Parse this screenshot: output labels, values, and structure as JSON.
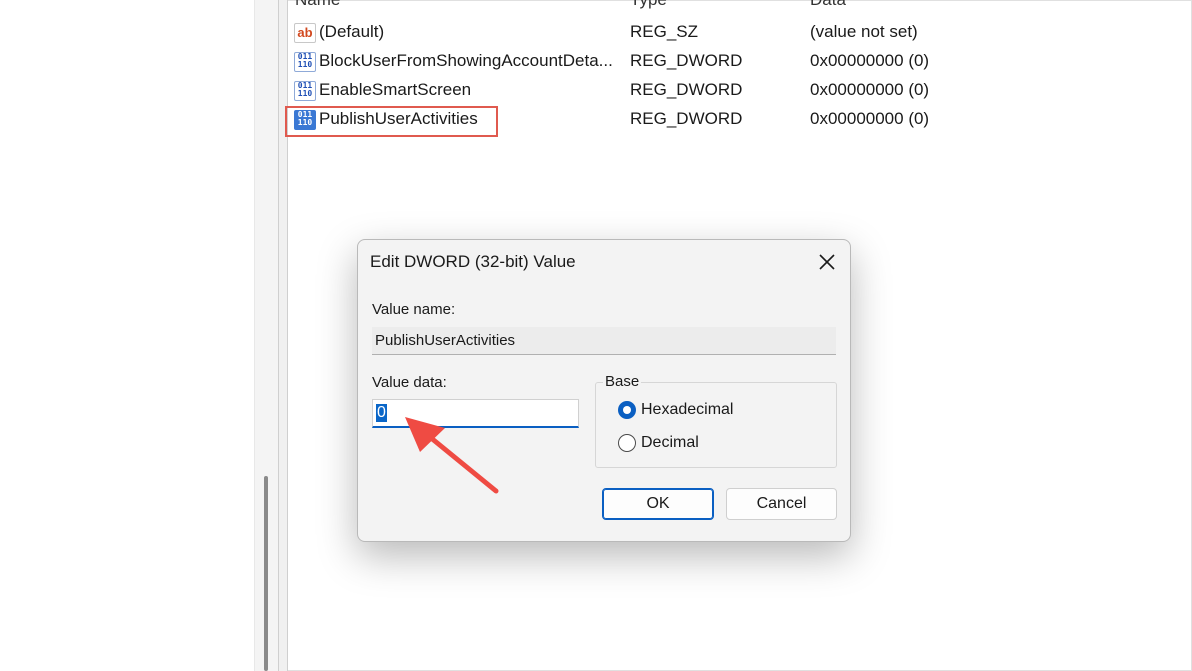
{
  "columns": {
    "name": "Name",
    "type": "Type",
    "data": "Data"
  },
  "rows": [
    {
      "icon": "string-value-icon",
      "icon_text": "ab",
      "name": "(Default)",
      "type": "REG_SZ",
      "data": "(value not set)"
    },
    {
      "icon": "dword-value-icon",
      "icon_text": "011\n110",
      "name": "BlockUserFromShowingAccountDeta...",
      "type": "REG_DWORD",
      "data": "0x00000000 (0)"
    },
    {
      "icon": "dword-value-icon",
      "icon_text": "011\n110",
      "name": "EnableSmartScreen",
      "type": "REG_DWORD",
      "data": "0x00000000 (0)"
    },
    {
      "icon": "dword-value-icon",
      "icon_text": "011\n110",
      "name": "PublishUserActivities",
      "type": "REG_DWORD",
      "data": "0x00000000 (0)"
    }
  ],
  "dialog": {
    "title": "Edit DWORD (32-bit) Value",
    "value_name_label": "Value name:",
    "value_name": "PublishUserActivities",
    "value_data_label": "Value data:",
    "value_data": "0",
    "base_label": "Base",
    "base_options": [
      {
        "label": "Hexadecimal",
        "selected": true
      },
      {
        "label": "Decimal",
        "selected": false
      }
    ],
    "ok_label": "OK",
    "cancel_label": "Cancel"
  },
  "colors": {
    "accent": "#0a5fc2",
    "highlight_box": "#e05a4f",
    "annotation_arrow": "#ef4b43"
  }
}
